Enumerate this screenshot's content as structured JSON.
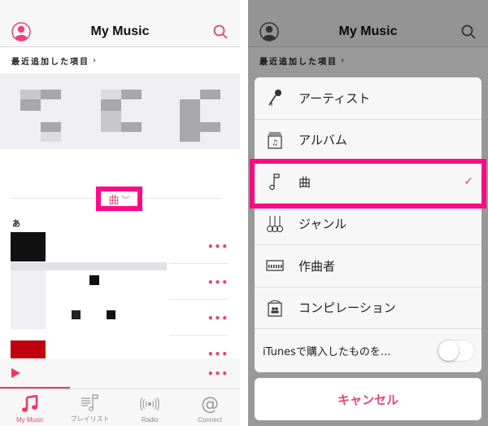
{
  "left_screen": {
    "header": {
      "title": "My Music",
      "avatar_icon": "profile-icon",
      "search_icon": "search-icon"
    },
    "recent": {
      "label": "最近追加した項目",
      "chevron": "›"
    },
    "sort": {
      "label": "曲",
      "chevron": "﹀"
    },
    "section_index": "あ",
    "song_more_label": "•••",
    "songs_count_visible": 4,
    "mini_player": {
      "play_icon": "play-icon",
      "more_label": "•••",
      "progress": 0.29
    },
    "tabs": [
      {
        "label": "My Music",
        "icon": "music-note-icon",
        "active": true
      },
      {
        "label": "プレイリスト",
        "icon": "playlist-icon",
        "active": false
      },
      {
        "label": "Radio",
        "icon": "radio-icon",
        "active": false
      },
      {
        "label": "Connect",
        "icon": "at-icon",
        "active": false
      }
    ]
  },
  "right_screen": {
    "header": {
      "title": "My Music"
    },
    "recent": {
      "label": "最近追加した項目",
      "chevron": "›"
    },
    "sort_menu": {
      "items": [
        {
          "label": "アーティスト",
          "icon": "microphone-icon",
          "selected": false
        },
        {
          "label": "アルバム",
          "icon": "album-icon",
          "selected": false
        },
        {
          "label": "曲",
          "icon": "song-note-icon",
          "selected": true
        },
        {
          "label": "ジャンル",
          "icon": "genre-icon",
          "selected": false
        },
        {
          "label": "作曲者",
          "icon": "piano-icon",
          "selected": false
        },
        {
          "label": "コンピレーション",
          "icon": "compilation-icon",
          "selected": false
        }
      ],
      "check_mark": "✓",
      "toggle": {
        "label": "iTunesで購入したものを...",
        "on": false
      },
      "cancel_label": "キャンセル"
    }
  },
  "colors": {
    "accent": "#e8437a",
    "highlight": "#ff0a84"
  }
}
